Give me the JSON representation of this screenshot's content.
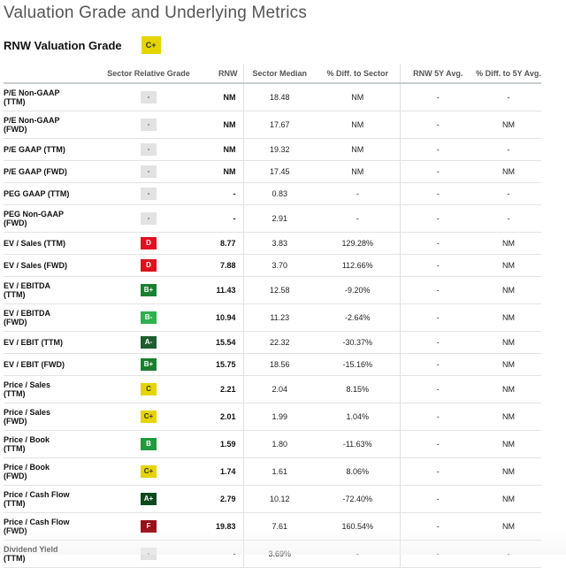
{
  "title": "Valuation Grade and Underlying Metrics",
  "valuation_grade": {
    "label": "RNW Valuation Grade",
    "grade": "C+"
  },
  "table": {
    "headers": [
      "",
      "Sector Relative Grade",
      "RNW",
      "Sector Median",
      "% Diff. to Sector",
      "RNW 5Y Avg.",
      "% Diff. to 5Y Avg."
    ],
    "rows": [
      {
        "metric": [
          "P/E Non-GAAP",
          "(TTM)"
        ],
        "grade": "-",
        "rnw": "NM",
        "sector_median": "18.48",
        "diff_sector": "NM",
        "avg5y": "-",
        "diff_5y": "-"
      },
      {
        "metric": [
          "P/E Non-GAAP",
          "(FWD)"
        ],
        "grade": "-",
        "rnw": "NM",
        "sector_median": "17.67",
        "diff_sector": "NM",
        "avg5y": "-",
        "diff_5y": "NM"
      },
      {
        "metric": [
          "P/E GAAP (TTM)"
        ],
        "grade": "-",
        "rnw": "NM",
        "sector_median": "19.32",
        "diff_sector": "NM",
        "avg5y": "-",
        "diff_5y": "-"
      },
      {
        "metric": [
          "P/E GAAP (FWD)"
        ],
        "grade": "-",
        "rnw": "NM",
        "sector_median": "17.45",
        "diff_sector": "NM",
        "avg5y": "-",
        "diff_5y": "NM"
      },
      {
        "metric": [
          "PEG GAAP (TTM)"
        ],
        "grade": "-",
        "rnw": "-",
        "sector_median": "0.83",
        "diff_sector": "-",
        "avg5y": "-",
        "diff_5y": "-"
      },
      {
        "metric": [
          "PEG Non-GAAP",
          "(FWD)"
        ],
        "grade": "-",
        "rnw": "-",
        "sector_median": "2.91",
        "diff_sector": "-",
        "avg5y": "-",
        "diff_5y": "-"
      },
      {
        "metric": [
          "EV / Sales (TTM)"
        ],
        "grade": "D",
        "rnw": "8.77",
        "sector_median": "3.83",
        "diff_sector": "129.28%",
        "avg5y": "-",
        "diff_5y": "NM"
      },
      {
        "metric": [
          "EV / Sales (FWD)"
        ],
        "grade": "D",
        "rnw": "7.88",
        "sector_median": "3.70",
        "diff_sector": "112.66%",
        "avg5y": "-",
        "diff_5y": "NM"
      },
      {
        "metric": [
          "EV / EBITDA",
          "(TTM)"
        ],
        "grade": "B+",
        "rnw": "11.43",
        "sector_median": "12.58",
        "diff_sector": "-9.20%",
        "avg5y": "-",
        "diff_5y": "NM"
      },
      {
        "metric": [
          "EV / EBITDA",
          "(FWD)"
        ],
        "grade": "B-",
        "rnw": "10.94",
        "sector_median": "11.23",
        "diff_sector": "-2.64%",
        "avg5y": "-",
        "diff_5y": "NM"
      },
      {
        "metric": [
          "EV / EBIT (TTM)"
        ],
        "grade": "A-",
        "rnw": "15.54",
        "sector_median": "22.32",
        "diff_sector": "-30.37%",
        "avg5y": "-",
        "diff_5y": "NM"
      },
      {
        "metric": [
          "EV / EBIT (FWD)"
        ],
        "grade": "B+",
        "rnw": "15.75",
        "sector_median": "18.56",
        "diff_sector": "-15.16%",
        "avg5y": "-",
        "diff_5y": "NM"
      },
      {
        "metric": [
          "Price / Sales",
          "(TTM)"
        ],
        "grade": "C",
        "rnw": "2.21",
        "sector_median": "2.04",
        "diff_sector": "8.15%",
        "avg5y": "-",
        "diff_5y": "NM"
      },
      {
        "metric": [
          "Price / Sales",
          "(FWD)"
        ],
        "grade": "C+",
        "rnw": "2.01",
        "sector_median": "1.99",
        "diff_sector": "1.04%",
        "avg5y": "-",
        "diff_5y": "NM"
      },
      {
        "metric": [
          "Price / Book",
          "(TTM)"
        ],
        "grade": "B",
        "rnw": "1.59",
        "sector_median": "1.80",
        "diff_sector": "-11.63%",
        "avg5y": "-",
        "diff_5y": "NM"
      },
      {
        "metric": [
          "Price / Book",
          "(FWD)"
        ],
        "grade": "C+",
        "rnw": "1.74",
        "sector_median": "1.61",
        "diff_sector": "8.06%",
        "avg5y": "-",
        "diff_5y": "NM"
      },
      {
        "metric": [
          "Price / Cash Flow",
          "(TTM)"
        ],
        "grade": "A+",
        "rnw": "2.79",
        "sector_median": "10.12",
        "diff_sector": "-72.40%",
        "avg5y": "-",
        "diff_5y": "NM"
      },
      {
        "metric": [
          "Price / Cash Flow",
          "(FWD)"
        ],
        "grade": "F",
        "rnw": "19.83",
        "sector_median": "7.61",
        "diff_sector": "160.54%",
        "avg5y": "-",
        "diff_5y": "NM"
      },
      {
        "metric": [
          "Dividend Yield",
          "(TTM)"
        ],
        "grade": "-",
        "rnw": "-",
        "sector_median": "3.69%",
        "diff_sector": "-",
        "avg5y": "-",
        "diff_5y": "-"
      }
    ]
  },
  "grade_colors": {
    "-": "#e2e2e2",
    "D": "#e0101e",
    "F": "#9a0e18",
    "C": "#e6d400",
    "C+": "#e6d400",
    "B+": "#1a7f2e",
    "B-": "#2fb04f",
    "B": "#1f9a3c",
    "A-": "#1e5e2e",
    "A+": "#0c4a1c"
  }
}
